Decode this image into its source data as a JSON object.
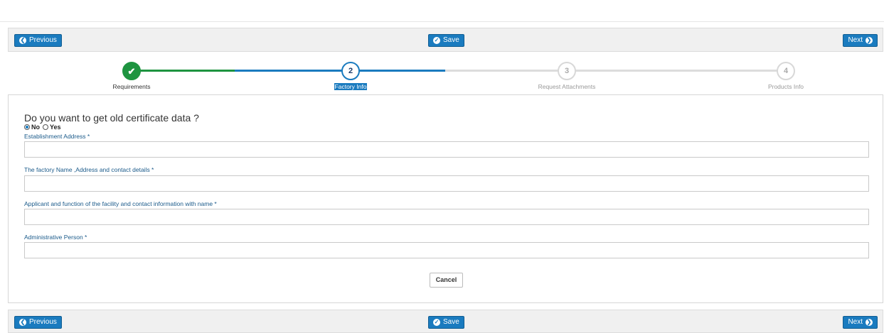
{
  "actions": {
    "previous_label": "Previous",
    "save_label": "Save",
    "next_label": "Next"
  },
  "stepper": {
    "steps": [
      {
        "number": "1",
        "label": "Requirements",
        "state": "done"
      },
      {
        "number": "2",
        "label": "Factory Info",
        "state": "active"
      },
      {
        "number": "3",
        "label": "Request Attachments",
        "state": "todo"
      },
      {
        "number": "4",
        "label": "Products Info",
        "state": "todo"
      }
    ],
    "colors": {
      "done": "#1e9440",
      "active": "#1a7bbf",
      "todo": "#d8d8d8"
    }
  },
  "form": {
    "question": "Do you want to get old certificate data ?",
    "options": {
      "no": "No",
      "yes": "Yes",
      "selected": "No"
    },
    "fields": [
      {
        "label": "Establishment Address *",
        "value": ""
      },
      {
        "label": "The factory Name ,Address and contact details *",
        "value": ""
      },
      {
        "label": "Applicant and function of the facility and contact information with name *",
        "value": ""
      },
      {
        "label": "Administrative Person *",
        "value": ""
      }
    ],
    "cancel_label": "Cancel"
  }
}
